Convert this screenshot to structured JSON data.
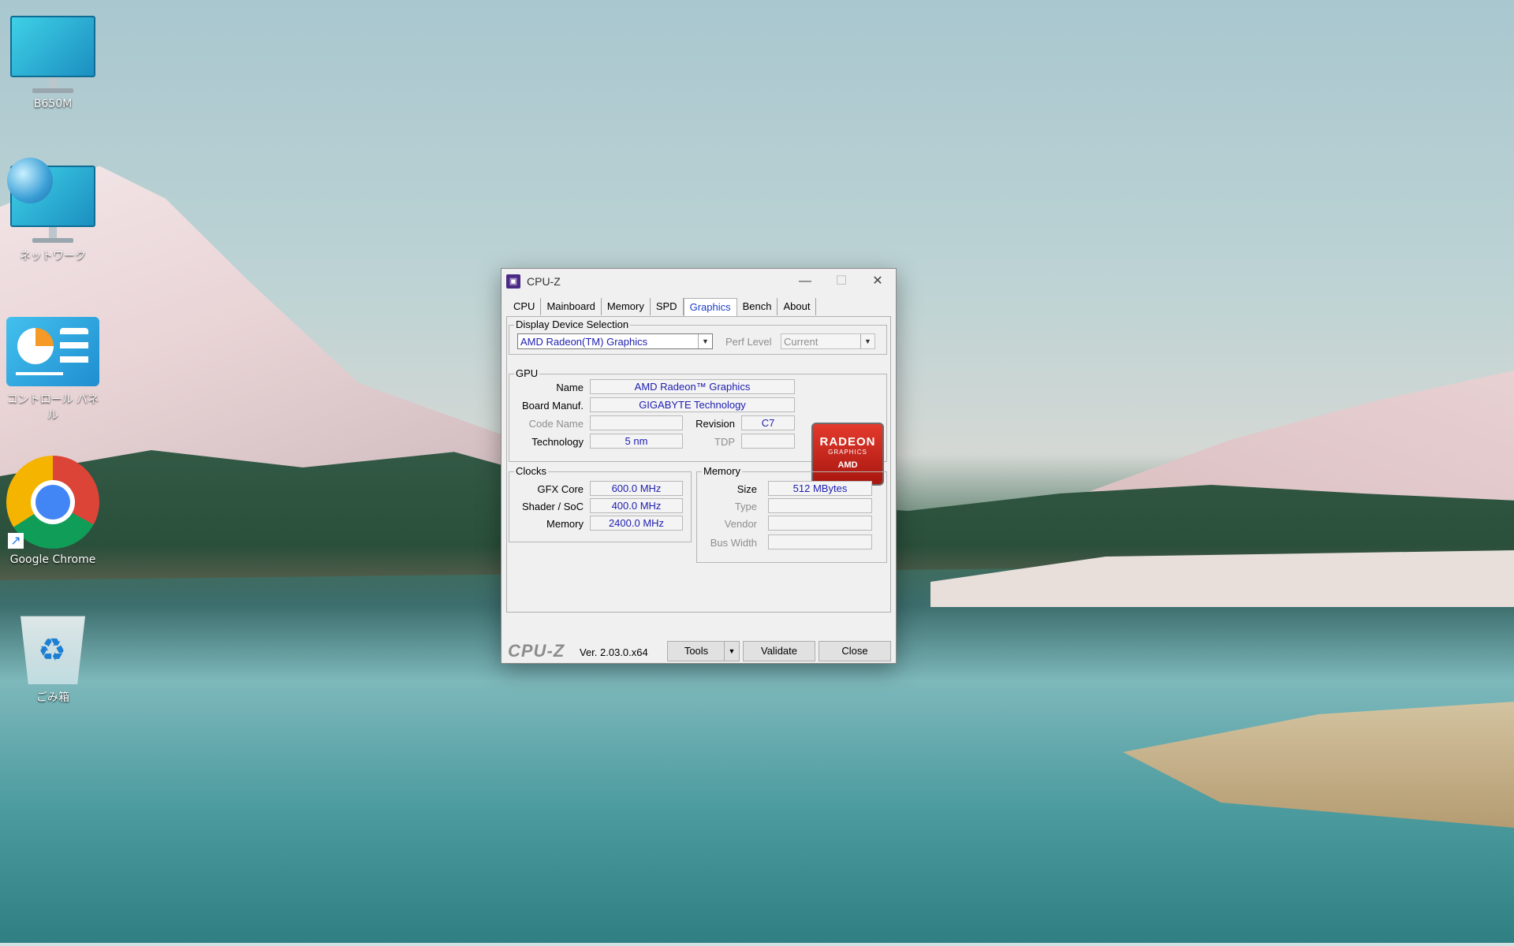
{
  "desktop": {
    "icons": [
      {
        "label": "B650M",
        "icon": "monitor-icon"
      },
      {
        "label": "ネットワーク",
        "icon": "network-icon"
      },
      {
        "label": "コントロール パネル",
        "icon": "control-panel-icon"
      },
      {
        "label": "Google Chrome",
        "icon": "chrome-icon"
      },
      {
        "label": "ごみ箱",
        "icon": "recycle-bin-icon"
      }
    ]
  },
  "window": {
    "title": "CPU-Z",
    "controls": {
      "minimize": "—",
      "maximize": "☐",
      "close": "✕"
    },
    "tabs": [
      "CPU",
      "Mainboard",
      "Memory",
      "SPD",
      "Graphics",
      "Bench",
      "About"
    ],
    "active_tab": "Graphics",
    "display_selection": {
      "group_label": "Display Device Selection",
      "device": "AMD Radeon(TM) Graphics",
      "perf_label": "Perf Level",
      "perf_value": "Current"
    },
    "gpu": {
      "group_label": "GPU",
      "name_label": "Name",
      "name": "AMD Radeon™ Graphics",
      "board_label": "Board Manuf.",
      "board": "GIGABYTE Technology",
      "code_label": "Code Name",
      "code": "",
      "revision_label": "Revision",
      "revision": "C7",
      "tech_label": "Technology",
      "tech": "5 nm",
      "tdp_label": "TDP",
      "tdp": "",
      "logo_line1": "RADEON",
      "logo_line2": "GRAPHICS",
      "logo_line3": "AMD"
    },
    "clocks": {
      "group_label": "Clocks",
      "gfx_label": "GFX Core",
      "gfx": "600.0 MHz",
      "shader_label": "Shader / SoC",
      "shader": "400.0 MHz",
      "mem_label": "Memory",
      "mem": "2400.0 MHz"
    },
    "memory": {
      "group_label": "Memory",
      "size_label": "Size",
      "size": "512 MBytes",
      "type_label": "Type",
      "type": "",
      "vendor_label": "Vendor",
      "vendor": "",
      "bus_label": "Bus Width",
      "bus": ""
    },
    "footer": {
      "logo": "CPU-Z",
      "version": "Ver. 2.03.0.x64",
      "tools": "Tools",
      "validate": "Validate",
      "close": "Close"
    }
  }
}
